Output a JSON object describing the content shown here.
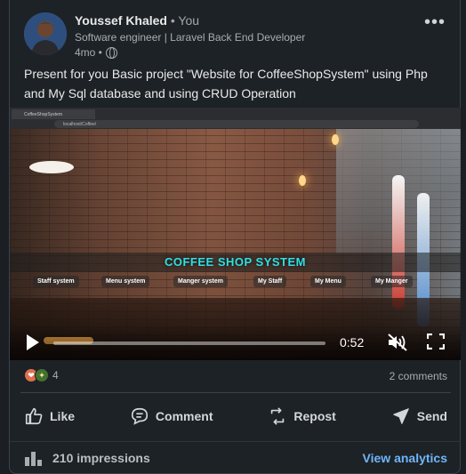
{
  "author": {
    "name": "Youssef Khaled",
    "you_label": "• You",
    "headline": "Software engineer | Laravel Back End Developer",
    "time": "4mo •",
    "visibility_icon": "globe-icon"
  },
  "menu": {
    "label": "•••"
  },
  "post": {
    "text": "Present for you Basic project \"Website for CoffeeShopSystem\" using Php and My Sql database and using CRUD Operation"
  },
  "video": {
    "browser_tab": "CoffeeShopSystem",
    "address": "localhost/Coffee/",
    "site_title": "COFFEE SHOP SYSTEM",
    "site_nav": [
      "Staff system",
      "Menu system",
      "Manger system",
      "My Staff",
      "My Menu",
      "My Manger"
    ],
    "duration": "0:52",
    "progress": 0.0,
    "play_icon": "play-icon",
    "mute_icon": "speaker-muted-icon",
    "fullscreen_icon": "fullscreen-icon"
  },
  "social": {
    "reactions": [
      "love-icon",
      "insightful-icon"
    ],
    "reaction_count": "4",
    "comments": "2 comments"
  },
  "actions": [
    {
      "label": "Like",
      "icon": "thumbs-up-icon"
    },
    {
      "label": "Comment",
      "icon": "comment-icon"
    },
    {
      "label": "Repost",
      "icon": "repost-icon"
    },
    {
      "label": "Send",
      "icon": "send-icon"
    }
  ],
  "stats": {
    "impressions": "210 impressions",
    "analytics_link": "View analytics"
  }
}
